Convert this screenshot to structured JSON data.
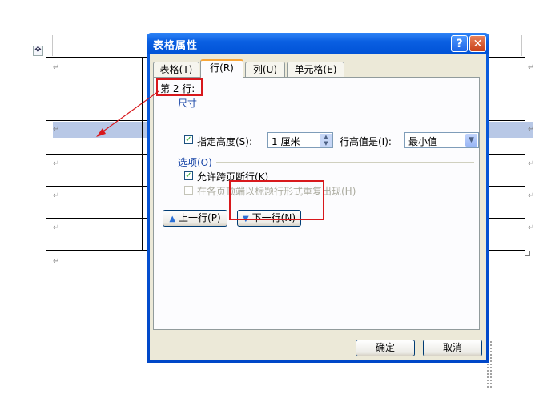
{
  "document": {
    "move_handle_glyph": "✥",
    "para_mark": "↵"
  },
  "dialog": {
    "title": "表格属性",
    "help_label": "?",
    "close_label": "✕",
    "tabs": [
      {
        "label": "表格(T)"
      },
      {
        "label": "行(R)"
      },
      {
        "label": "列(U)"
      },
      {
        "label": "单元格(E)"
      }
    ],
    "row_title": "第 2 行:",
    "size_group": "尺寸",
    "specify_height_label": "指定高度(S):",
    "height_value": "1 厘米",
    "row_height_is_label": "行高值是(I):",
    "row_height_mode": "最小值",
    "options_group": "选项(O)",
    "allow_break_label": "允许跨页断行(K)",
    "allow_break_checked": true,
    "repeat_header_label": "在各页顶端以标题行形式重复出现(H)",
    "repeat_header_checked": false,
    "prev_row_label": "上一行(P)",
    "next_row_label": "下一行(N)",
    "ok_label": "确定",
    "cancel_label": "取消",
    "check_glyph": "✓"
  },
  "colors": {
    "titlebar": "#0a5fe2",
    "annotation_red": "#d8181c",
    "row_highlight": "#b8c8e6"
  }
}
